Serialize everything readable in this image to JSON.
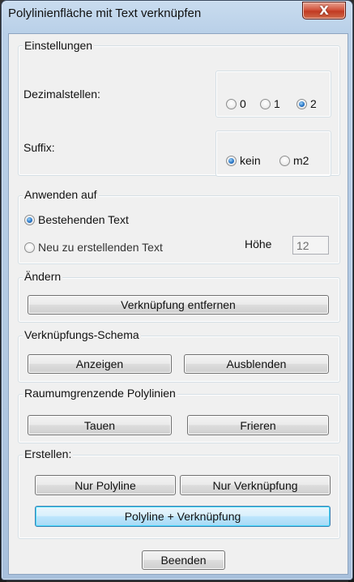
{
  "window": {
    "title": "Polylinienfläche mit Text verknüpfen",
    "close_glyph": "X"
  },
  "einstellungen": {
    "title": "Einstellungen",
    "dezimalstellen_label": "Dezimalstellen:",
    "dezimal_options": [
      {
        "label": "0",
        "selected": false
      },
      {
        "label": "1",
        "selected": false
      },
      {
        "label": "2",
        "selected": true
      }
    ],
    "suffix_label": "Suffix:",
    "suffix_options": [
      {
        "label": "kein",
        "selected": true
      },
      {
        "label": "m2",
        "selected": false
      }
    ]
  },
  "anwenden": {
    "title": "Anwenden auf",
    "options": [
      {
        "label": "Bestehenden Text",
        "selected": true
      },
      {
        "label": "Neu zu erstellenden Text",
        "selected": false
      }
    ],
    "hoehe_label": "Höhe",
    "hoehe_value": "12"
  },
  "aendern": {
    "title": "Ändern",
    "button": "Verknüpfung entfernen"
  },
  "schema": {
    "title": "Verknüpfungs-Schema",
    "show_button": "Anzeigen",
    "hide_button": "Ausblenden"
  },
  "raum": {
    "title": "Raumumgrenzende Polylinien",
    "thaw_button": "Tauen",
    "freeze_button": "Frieren"
  },
  "erstellen": {
    "title": "Erstellen:",
    "polyline_button": "Nur Polyline",
    "link_button": "Nur Verknüpfung",
    "both_button": "Polyline + Verknüpfung"
  },
  "footer": {
    "close_button": "Beenden"
  },
  "colors": {
    "dialog_bg": "#f0f0f0",
    "title_bar": "#b9d0e8",
    "close_button": "#c13a22",
    "radio_selected": "#2a78c8",
    "default_button_border": "#3c7fb1"
  }
}
